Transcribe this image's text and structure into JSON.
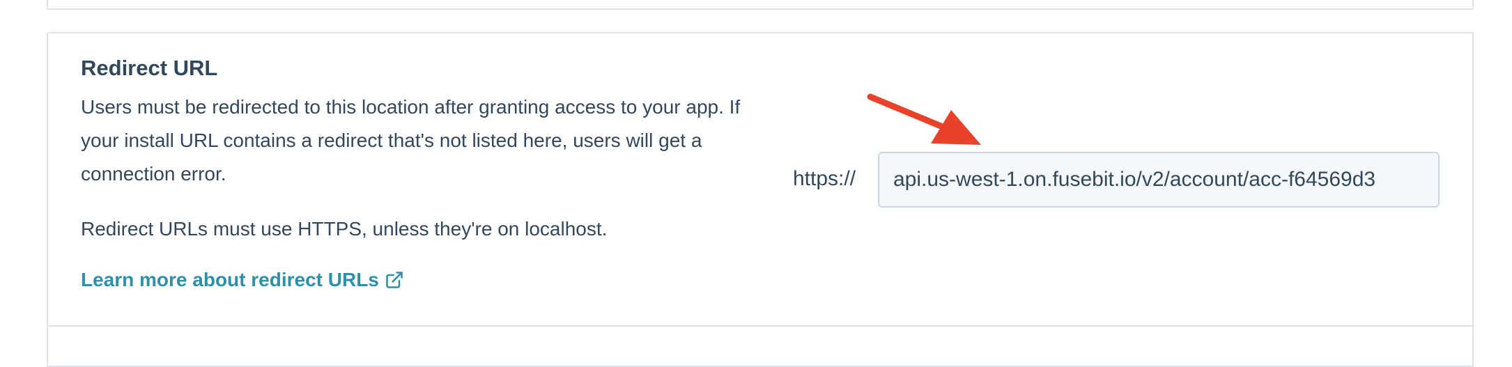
{
  "section": {
    "title": "Redirect URL",
    "description": "Users must be redirected to this location after granting access to your app. If your install URL contains a redirect that's not listed here, users will get a connection error.",
    "https_note": "Redirect URLs must use HTTPS, unless they're on localhost.",
    "learn_more_link": "Learn more about redirect URLs"
  },
  "redirect_field": {
    "prefix": "https://",
    "value": "api.us-west-1.on.fusebit.io/v2/account/acc-f64569d3"
  },
  "icons": {
    "external_link": "external-link-icon",
    "annotation_arrow": "arrow-annotation"
  },
  "colors": {
    "link": "#2f8fa8",
    "text": "#33475b",
    "arrow": "#e8432a"
  }
}
